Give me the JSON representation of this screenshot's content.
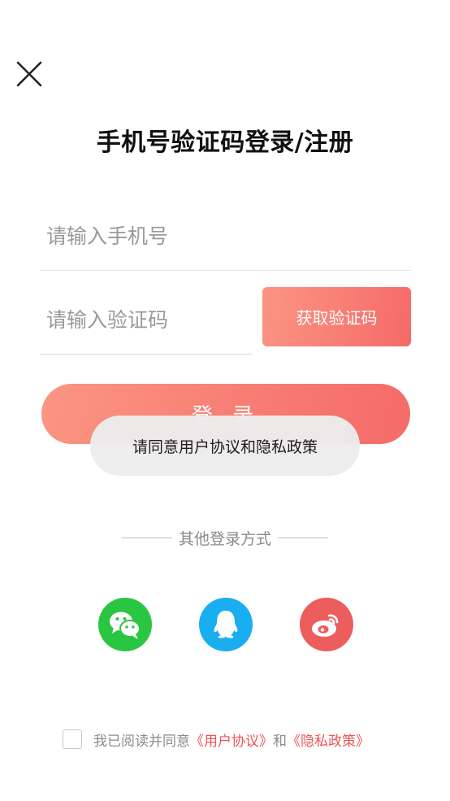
{
  "header": {
    "close_icon": "close-icon",
    "title": "手机号验证码登录/注册"
  },
  "form": {
    "phone_placeholder": "请输入手机号",
    "phone_value": "",
    "code_placeholder": "请输入验证码",
    "code_value": "",
    "get_code_label": "获取验证码",
    "login_label": "登 录"
  },
  "toast": {
    "message": "请同意用户协议和隐私政策"
  },
  "other_login": {
    "divider_label": "其他登录方式",
    "providers": [
      {
        "name": "wechat",
        "icon": "wechat-icon",
        "color": "#2ac641"
      },
      {
        "name": "qq",
        "icon": "qq-icon",
        "color": "#19aef0"
      },
      {
        "name": "weibo",
        "icon": "weibo-icon",
        "color": "#ec5d5e"
      }
    ]
  },
  "agreement": {
    "checked": false,
    "prefix": "我已阅读并同意",
    "user_agreement": "《用户协议》",
    "conjunction": "和",
    "privacy_policy": "《隐私政策》"
  },
  "theme": {
    "accent_start": "#fb9583",
    "accent_end": "#f56a68",
    "link_color": "#ee5555"
  }
}
